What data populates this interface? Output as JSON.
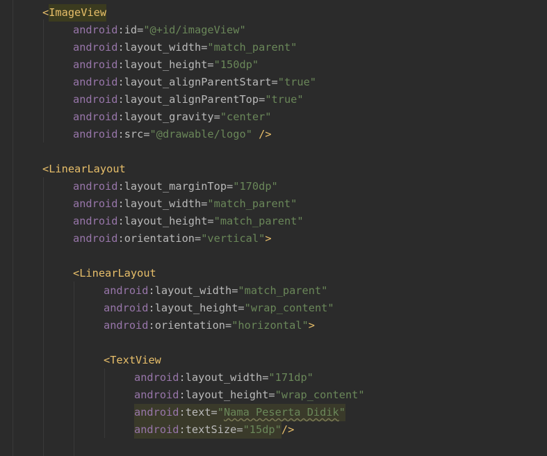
{
  "code": [
    {
      "indent": 0,
      "tokens": [
        {
          "t": "<",
          "c": "tag"
        },
        {
          "t": "ImageView",
          "c": "tag",
          "hl": true
        }
      ]
    },
    {
      "indent": 1,
      "tokens": [
        {
          "t": "android",
          "c": "ns"
        },
        {
          "t": ":",
          "c": "colon"
        },
        {
          "t": "id",
          "c": "attr"
        },
        {
          "t": "=",
          "c": "eq"
        },
        {
          "t": "\"@+id/imageView\"",
          "c": "str"
        }
      ]
    },
    {
      "indent": 1,
      "tokens": [
        {
          "t": "android",
          "c": "ns"
        },
        {
          "t": ":",
          "c": "colon"
        },
        {
          "t": "layout_width",
          "c": "attr"
        },
        {
          "t": "=",
          "c": "eq"
        },
        {
          "t": "\"match_parent\"",
          "c": "str"
        }
      ]
    },
    {
      "indent": 1,
      "tokens": [
        {
          "t": "android",
          "c": "ns"
        },
        {
          "t": ":",
          "c": "colon"
        },
        {
          "t": "layout_height",
          "c": "attr"
        },
        {
          "t": "=",
          "c": "eq"
        },
        {
          "t": "\"150dp\"",
          "c": "str"
        }
      ]
    },
    {
      "indent": 1,
      "tokens": [
        {
          "t": "android",
          "c": "ns"
        },
        {
          "t": ":",
          "c": "colon"
        },
        {
          "t": "layout_alignParentStart",
          "c": "attr"
        },
        {
          "t": "=",
          "c": "eq"
        },
        {
          "t": "\"true\"",
          "c": "str"
        }
      ]
    },
    {
      "indent": 1,
      "tokens": [
        {
          "t": "android",
          "c": "ns"
        },
        {
          "t": ":",
          "c": "colon"
        },
        {
          "t": "layout_alignParentTop",
          "c": "attr"
        },
        {
          "t": "=",
          "c": "eq"
        },
        {
          "t": "\"true\"",
          "c": "str"
        }
      ]
    },
    {
      "indent": 1,
      "tokens": [
        {
          "t": "android",
          "c": "ns"
        },
        {
          "t": ":",
          "c": "colon"
        },
        {
          "t": "layout_gravity",
          "c": "attr"
        },
        {
          "t": "=",
          "c": "eq"
        },
        {
          "t": "\"center\"",
          "c": "str"
        }
      ]
    },
    {
      "indent": 1,
      "tokens": [
        {
          "t": "android",
          "c": "ns"
        },
        {
          "t": ":",
          "c": "colon"
        },
        {
          "t": "src",
          "c": "attr"
        },
        {
          "t": "=",
          "c": "eq"
        },
        {
          "t": "\"@drawable/logo\"",
          "c": "str"
        },
        {
          "t": " />",
          "c": "tag"
        }
      ]
    },
    {
      "indent": 0,
      "tokens": []
    },
    {
      "indent": 0,
      "tokens": [
        {
          "t": "<",
          "c": "tag"
        },
        {
          "t": "LinearLayout",
          "c": "tag"
        }
      ]
    },
    {
      "indent": 1,
      "tokens": [
        {
          "t": "android",
          "c": "ns"
        },
        {
          "t": ":",
          "c": "colon"
        },
        {
          "t": "layout_marginTop",
          "c": "attr"
        },
        {
          "t": "=",
          "c": "eq"
        },
        {
          "t": "\"170dp\"",
          "c": "str"
        }
      ]
    },
    {
      "indent": 1,
      "tokens": [
        {
          "t": "android",
          "c": "ns"
        },
        {
          "t": ":",
          "c": "colon"
        },
        {
          "t": "layout_width",
          "c": "attr"
        },
        {
          "t": "=",
          "c": "eq"
        },
        {
          "t": "\"match_parent\"",
          "c": "str"
        }
      ]
    },
    {
      "indent": 1,
      "tokens": [
        {
          "t": "android",
          "c": "ns"
        },
        {
          "t": ":",
          "c": "colon"
        },
        {
          "t": "layout_height",
          "c": "attr"
        },
        {
          "t": "=",
          "c": "eq"
        },
        {
          "t": "\"match_parent\"",
          "c": "str"
        }
      ]
    },
    {
      "indent": 1,
      "tokens": [
        {
          "t": "android",
          "c": "ns"
        },
        {
          "t": ":",
          "c": "colon"
        },
        {
          "t": "orientation",
          "c": "attr"
        },
        {
          "t": "=",
          "c": "eq"
        },
        {
          "t": "\"vertical\"",
          "c": "str"
        },
        {
          "t": ">",
          "c": "tag"
        }
      ]
    },
    {
      "indent": 0,
      "tokens": []
    },
    {
      "indent": 1,
      "tokens": [
        {
          "t": "<",
          "c": "tag"
        },
        {
          "t": "LinearLayout",
          "c": "tag"
        }
      ]
    },
    {
      "indent": 2,
      "tokens": [
        {
          "t": "android",
          "c": "ns"
        },
        {
          "t": ":",
          "c": "colon"
        },
        {
          "t": "layout_width",
          "c": "attr"
        },
        {
          "t": "=",
          "c": "eq"
        },
        {
          "t": "\"match_parent\"",
          "c": "str"
        }
      ]
    },
    {
      "indent": 2,
      "tokens": [
        {
          "t": "android",
          "c": "ns"
        },
        {
          "t": ":",
          "c": "colon"
        },
        {
          "t": "layout_height",
          "c": "attr"
        },
        {
          "t": "=",
          "c": "eq"
        },
        {
          "t": "\"wrap_content\"",
          "c": "str"
        }
      ]
    },
    {
      "indent": 2,
      "tokens": [
        {
          "t": "android",
          "c": "ns"
        },
        {
          "t": ":",
          "c": "colon"
        },
        {
          "t": "orientation",
          "c": "attr"
        },
        {
          "t": "=",
          "c": "eq"
        },
        {
          "t": "\"horizontal\"",
          "c": "str"
        },
        {
          "t": ">",
          "c": "tag"
        }
      ]
    },
    {
      "indent": 0,
      "tokens": []
    },
    {
      "indent": 2,
      "tokens": [
        {
          "t": "<",
          "c": "tag"
        },
        {
          "t": "TextView",
          "c": "tag"
        }
      ]
    },
    {
      "indent": 3,
      "tokens": [
        {
          "t": "android",
          "c": "ns"
        },
        {
          "t": ":",
          "c": "colon"
        },
        {
          "t": "layout_width",
          "c": "attr"
        },
        {
          "t": "=",
          "c": "eq"
        },
        {
          "t": "\"171dp\"",
          "c": "str"
        }
      ]
    },
    {
      "indent": 3,
      "tokens": [
        {
          "t": "android",
          "c": "ns"
        },
        {
          "t": ":",
          "c": "colon"
        },
        {
          "t": "layout_height",
          "c": "attr"
        },
        {
          "t": "=",
          "c": "eq"
        },
        {
          "t": "\"wrap_content\"",
          "c": "str"
        }
      ]
    },
    {
      "indent": 3,
      "hl": true,
      "tokens": [
        {
          "t": "android",
          "c": "ns"
        },
        {
          "t": ":",
          "c": "colon"
        },
        {
          "t": "text",
          "c": "attr"
        },
        {
          "t": "=",
          "c": "eq"
        },
        {
          "t": "\"",
          "c": "str"
        },
        {
          "t": "Nama Peserta Didik",
          "c": "str",
          "warn": true
        },
        {
          "t": "\"",
          "c": "str"
        }
      ]
    },
    {
      "indent": 3,
      "hl": true,
      "tokens": [
        {
          "t": "android",
          "c": "ns"
        },
        {
          "t": ":",
          "c": "colon"
        },
        {
          "t": "textSize",
          "c": "attr"
        },
        {
          "t": "=",
          "c": "eq"
        },
        {
          "t": "\"15dp\"",
          "c": "str"
        },
        {
          "t": "/>",
          "c": "tag",
          "nohl": true
        }
      ]
    }
  ]
}
